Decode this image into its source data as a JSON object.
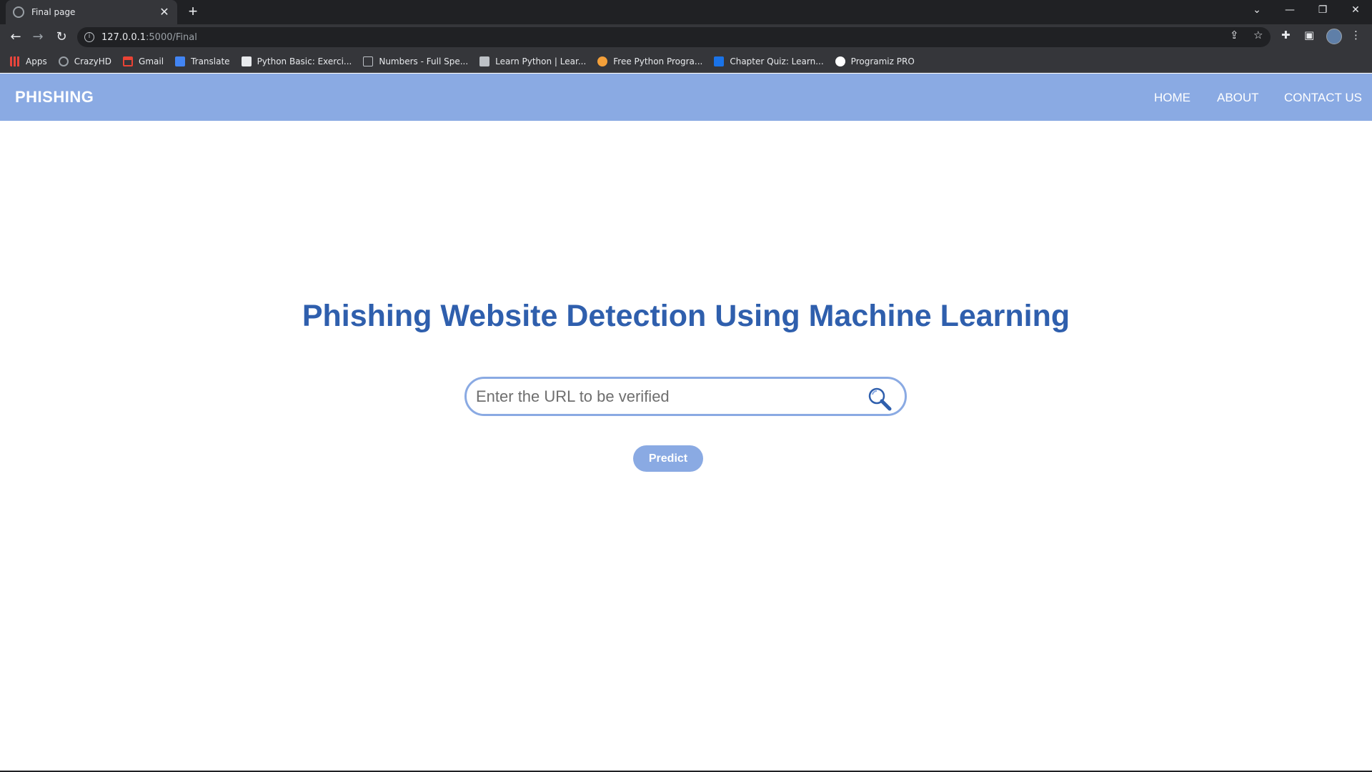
{
  "browser": {
    "tab_title": "Final page",
    "tab_close": "✕",
    "new_tab": "+",
    "url_host": "127.0.0.1",
    "url_path": ":5000/Final",
    "bookmarks": [
      {
        "label": "Apps",
        "icon": "apps-grid-icon",
        "color": "#e8453c"
      },
      {
        "label": "CrazyHD",
        "icon": "globe-icon",
        "color": "#9aa0a6"
      },
      {
        "label": "Gmail",
        "icon": "gmail-icon",
        "color": "#ea4335"
      },
      {
        "label": "Translate",
        "icon": "google-translate-icon",
        "color": "#4285f4"
      },
      {
        "label": "Python Basic: Exerci...",
        "icon": "w3resource-icon",
        "color": "#e8eaed"
      },
      {
        "label": "Numbers - Full Spe...",
        "icon": "terminal-icon",
        "color": "#bdc1c6"
      },
      {
        "label": "Learn Python | Lear...",
        "icon": "page-icon",
        "color": "#bdc1c6"
      },
      {
        "label": "Free Python Progra...",
        "icon": "bird-icon",
        "color": "#f4a03a"
      },
      {
        "label": "Chapter Quiz: Learn...",
        "icon": "play-icon",
        "color": "#1a73e8"
      },
      {
        "label": "Programiz PRO",
        "icon": "programiz-icon",
        "color": "#ffffff"
      }
    ]
  },
  "navbar": {
    "brand": "PHISHING",
    "links": [
      "HOME",
      "ABOUT",
      "CONTACT US"
    ]
  },
  "main": {
    "heading": "Phishing Website Detection Using Machine Learning",
    "url_input_placeholder": "Enter the URL to be verified",
    "url_input_value": "",
    "predict_label": "Predict"
  },
  "colors": {
    "accent": "#8aaae3",
    "heading": "#2f5fad"
  }
}
